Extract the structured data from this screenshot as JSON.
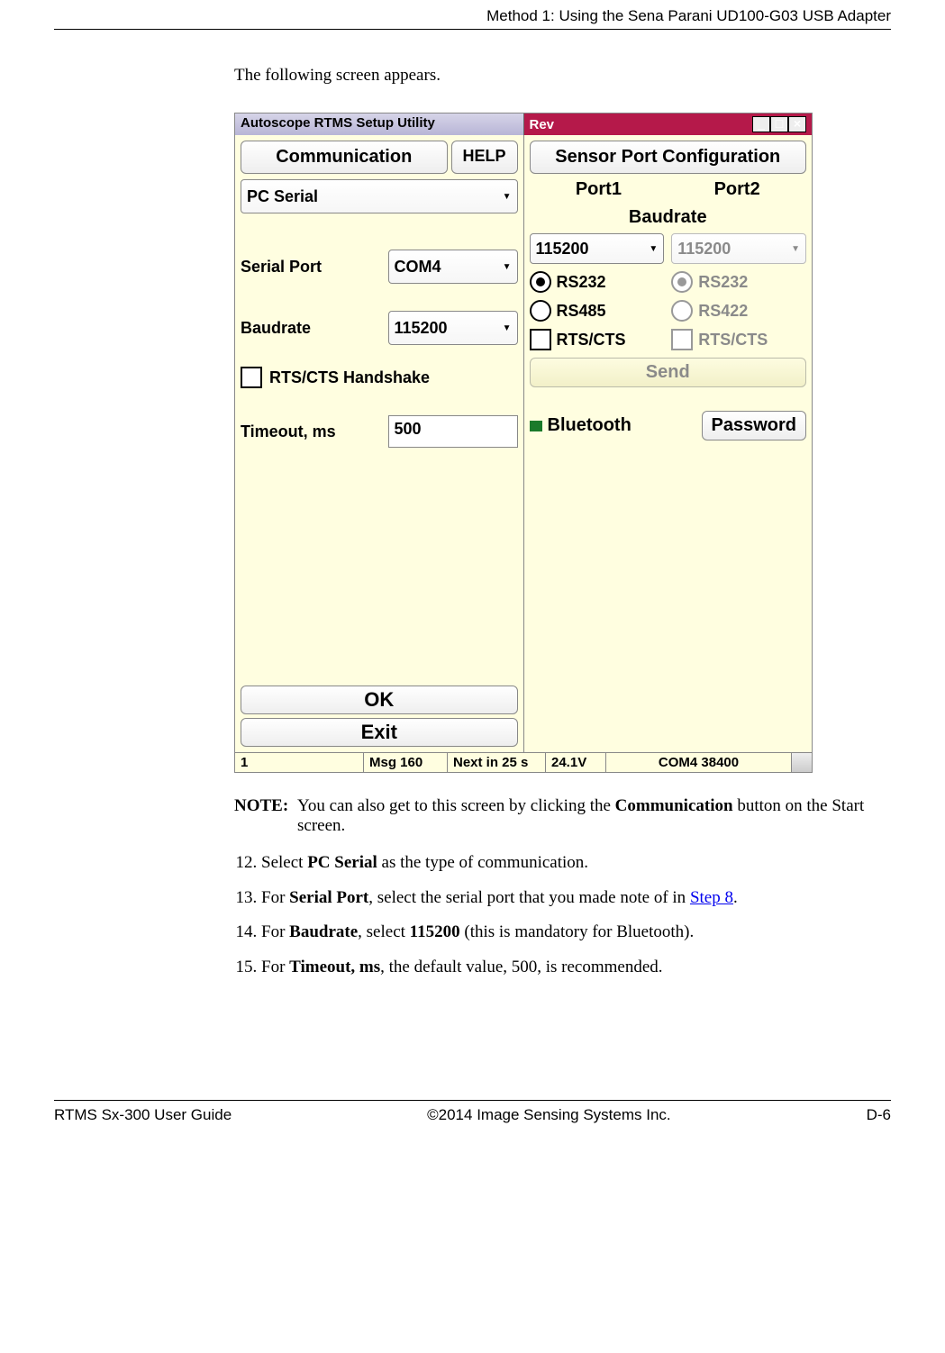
{
  "header": {
    "section": "Method 1: Using the Sena Parani UD100-G03 USB Adapter"
  },
  "intro": "The following screen appears.",
  "app": {
    "title_left": "Autoscope RTMS Setup Utility",
    "title_right": "Rev",
    "left": {
      "header_main": "Communication",
      "header_help": "HELP",
      "conn_type": "PC Serial",
      "serial_port_label": "Serial Port",
      "serial_port_value": "COM4",
      "baudrate_label": "Baudrate",
      "baudrate_value": "115200",
      "rtscts_label": "RTS/CTS Handshake",
      "timeout_label": "Timeout, ms",
      "timeout_value": "500",
      "ok": "OK",
      "exit": "Exit"
    },
    "right": {
      "header": "Sensor Port Configuration",
      "port1": "Port1",
      "port2": "Port2",
      "baud_header": "Baudrate",
      "p1": {
        "baud": "115200",
        "rs232": "RS232",
        "rs485": "RS485",
        "rtscts": "RTS/CTS"
      },
      "p2": {
        "baud": "115200",
        "rs232": "RS232",
        "rs422": "RS422",
        "rtscts": "RTS/CTS"
      },
      "send": "Send",
      "bluetooth": "Bluetooth",
      "password": "Password"
    },
    "status": {
      "a": "1",
      "b": "Msg 160",
      "c": "Next in 25 s",
      "d": "24.1V",
      "e": "COM4 38400"
    }
  },
  "note": {
    "label": "NOTE:",
    "text_before": "You can also get to this screen by clicking the ",
    "bold1": "Communication",
    "text_after": " button on the Start screen."
  },
  "steps": {
    "s12a": "Select ",
    "s12b": "PC Serial",
    "s12c": " as the type of communication.",
    "s13a": "For ",
    "s13b": "Serial Port",
    "s13c": ", select the serial port that you made note of in ",
    "s13link": "Step 8",
    "s13d": ".",
    "s14a": "For ",
    "s14b": "Baudrate",
    "s14c": ", select ",
    "s14d": "115200",
    "s14e": " (this is mandatory for Bluetooth).",
    "s15a": "For ",
    "s15b": "Timeout, ms",
    "s15c": ", the default value, 500, is recommended."
  },
  "footer": {
    "left": "RTMS Sx-300 User Guide",
    "center": "©2014 Image Sensing Systems Inc.",
    "right": "D-6"
  }
}
